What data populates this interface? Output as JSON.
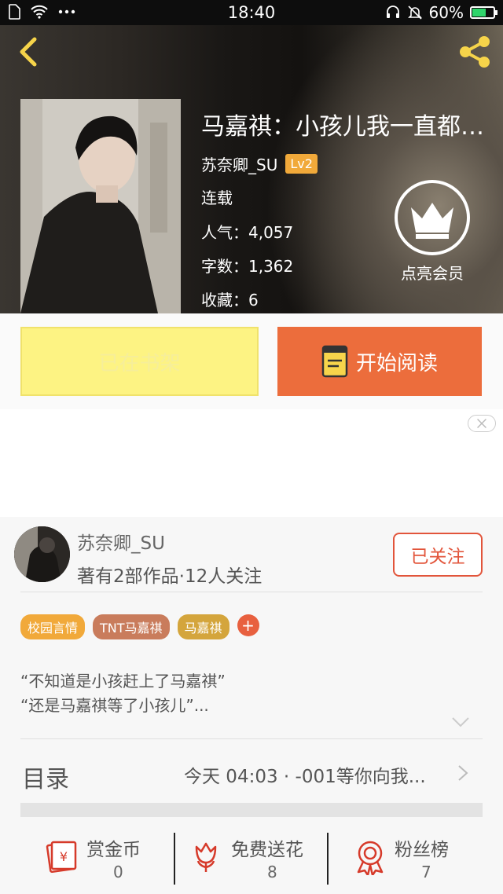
{
  "status_bar": {
    "time": "18:40",
    "battery": "60%",
    "battery_level": 0.6
  },
  "book": {
    "title": "马嘉祺：小孩儿我一直都…",
    "author": "苏奈卿_SU",
    "level": "Lv2",
    "status": "连载",
    "popularity": "人气：4,057",
    "words": "字数：1,362",
    "favorites": "收藏：6"
  },
  "vip": {
    "label": "点亮会员"
  },
  "actions": {
    "shelf_label": "已在书架",
    "read_label": "开始阅读"
  },
  "author_card": {
    "name": "苏奈卿_SU",
    "works": "著有2部作品·12人关注",
    "follow_label": "已关注"
  },
  "tags": [
    "校园言情",
    "TNT马嘉祺",
    "马嘉祺"
  ],
  "tag_add": "+",
  "intro": [
    "“不知道是小孩赶上了马嘉祺”",
    "“还是马嘉祺等了小孩儿”..."
  ],
  "catalog": {
    "title": "目录",
    "latest": "今天 04:03 · -001等你向我..."
  },
  "stats": [
    {
      "label": "赏金币",
      "value": "0"
    },
    {
      "label": "免费送花",
      "value": "8"
    },
    {
      "label": "粉丝榜",
      "value": "7"
    }
  ],
  "colors": {
    "accent": "#ec6d3c",
    "shelf": "#fdf383",
    "follow": "#e2553b",
    "tag1": "#f1a93a",
    "tag2": "#c97c5c",
    "tag3": "#d4a53c"
  }
}
